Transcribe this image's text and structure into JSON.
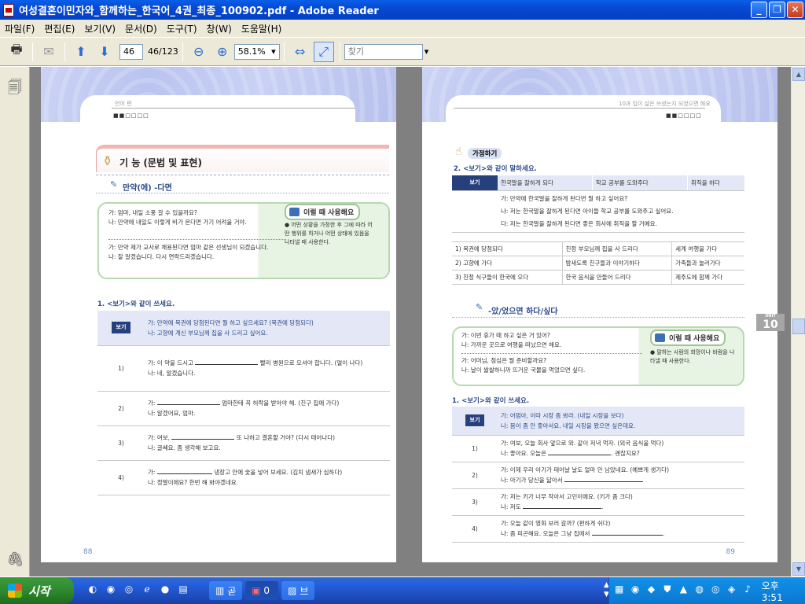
{
  "window": {
    "title": "여성결혼이민자와_함께하는_한국어_4권_최종_100902.pdf - Adobe Reader"
  },
  "menu": [
    "파일(F)",
    "편집(E)",
    "보기(V)",
    "문서(D)",
    "도구(T)",
    "창(W)",
    "도움말(H)"
  ],
  "toolbar": {
    "page_value": "46",
    "page_of": "46/123",
    "zoom": "58.1%",
    "find_placeholder": "찾기"
  },
  "taskbar": {
    "start": "시작",
    "tasks": [
      "곧",
      "0",
      "브"
    ],
    "clock": "오후 3:51"
  },
  "left_page": {
    "header": "언어 편",
    "dots": "■■□□□□",
    "section_title": "기 능 (문법 및 표현)",
    "grammar_title": "만약(에) -다면",
    "dialogue": [
      "가: 엄마, 내일 소풍 갈 수 있을까요?",
      "나: 만약에 내일도 이렇게 비가 온다면 가기 어려울 거야.",
      "가: 만약 제가 교사로 채용된다면 엄마 같은 선생님이 되겠습니다.",
      "나: 잘 알겠습니다. 다시 연락드리겠습니다."
    ],
    "usage_tag": "이럴 때 사용해요",
    "usage_note": "● 어떤 상황을 가정한 후 그에 따라 어떤 행위를 하거나 어떤 상태에 있음을 나타낼 때 사용한다.",
    "q_title": "1. <보기>와 같이 쓰세요.",
    "example_label": "보기",
    "example": [
      "가: 만약에 복권에 당첨된다면 뭘 하고 싶으세요? (복권에 당첨되다)",
      "나: 고향에 계신 부모님께 집을 사 드리고 싶어요."
    ],
    "rows": [
      {
        "n": "1)",
        "a": "가: 이 약을 드시고",
        "a2": "빨리 병원으로 오셔야 합니다. (열이 나다)",
        "b": "나: 네, 알겠습니다."
      },
      {
        "n": "2)",
        "a": "가:",
        "a2": "엄마한테 꼭 허락을 받아야 해. (친구 집에 가다)",
        "b": "나: 알겠어요, 엄마."
      },
      {
        "n": "3)",
        "a": "가: 여보,",
        "a2": "또 나하고 결혼할 거야? (다시 태어나다)",
        "b": "나: 글쎄요. 좀 생각해 보고요."
      },
      {
        "n": "4)",
        "a": "가:",
        "a2": "냉장고 안에 숯을 넣어 보세요. (김치 냄새가 심하다)",
        "b": "나: 정말이에요? 한번 해 봐야겠네요."
      }
    ],
    "page_number": "88"
  },
  "right_page": {
    "header": "10과  입이 삶은 쓰셨는지 되었으면 해요",
    "dots": "■■□□□□",
    "practice_tag": "가정하기",
    "q2_title": "2. <보기>와 같이 말하세요.",
    "ex2_label": "보기",
    "ex2_options": [
      "한국말을 잘하게 되다",
      "학교 공부를 도와주다",
      "취직을 하다"
    ],
    "ex2_lines": [
      "가: 만약에 한국말을 잘하게 된다면 뭘 하고 싶어요?",
      "나: 저는 한국말을 잘하게 된다면 아이들 학교 공부를 도와주고 싶어요.",
      "다: 저는 한국말을 잘하게 된다면 좋은 회사에 취직을 할 거예요."
    ],
    "grid": [
      [
        "1) 복권에 당첨되다",
        "친정 부모님께 집을 사 드리다",
        "세계 여행을 가다"
      ],
      [
        "2) 고향에 가다",
        "밤새도록 친구들과 이야기하다",
        "가족들과 놀러가다"
      ],
      [
        "3) 친정 식구들이 한국에 오다",
        "한국 음식을 만들어 드리다",
        "제주도에 함께 가다"
      ]
    ],
    "grammar_title": "-았/었으면 하다/싶다",
    "dialogue": [
      "가: 이번 휴가 때 하고 싶은 거 있어?",
      "나: 가까운 곳으로 여행을 떠났으면 해요.",
      "가: 어머님, 점심은 뭘 준비할까요?",
      "나: 날이 쌀쌀하니까 뜨거운 국물을 먹었으면 싶다."
    ],
    "usage_tag": "이럴 때 사용해요",
    "usage_note": "● 말하는 사람의 희망이나 바람을 나타낼 때 사용한다.",
    "q_title": "1. <보기>와 같이 쓰세요.",
    "example_label": "보기",
    "example": [
      "가: 어멈아, 이따 시장 좀 봐라. (내일 시장을 보다)",
      "나: 몸이 좀 안 좋아서요. 내일 시장을 봤으면 싶은데요."
    ],
    "rows": [
      {
        "n": "1)",
        "a": "가: 여보, 오늘 회사 앞으로 와. 같이 저녁 먹자. (외국 음식을 먹다)",
        "b": "나: 좋아요. 오늘은",
        "b2": ". 괜찮지요?"
      },
      {
        "n": "2)",
        "a": "가: 이제 우리 아기가 태어날 날도 얼마 안 남았네요. (예쁘게 생기다)",
        "b": "나: 아기가 당신을 닮아서",
        "b2": ""
      },
      {
        "n": "3)",
        "a": "가: 저는 키가 너무 작아서 고민이에요. (키가 좀 크다)",
        "b": "나: 저도",
        "b2": "."
      },
      {
        "n": "4)",
        "a": "가: 오늘 같이 영화 보러 갈까? (편하게 쉬다)",
        "b": "나: 좀 피곤해요. 오늘은 그냥 집에서",
        "b2": "."
      }
    ],
    "side_tab_small": "UNIT",
    "side_tab": "10",
    "page_number": "89"
  }
}
